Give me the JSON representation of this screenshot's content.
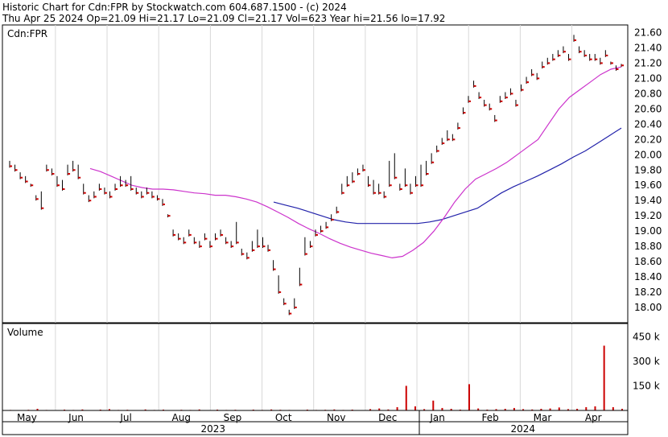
{
  "header": {
    "line1": "Historic Chart for Cdn:FPR by Stockwatch.com 604.687.1500 - (c) 2024",
    "line2": "Thu Apr 25 2024   Op=21.09   Hi=21.17   Lo=21.09   Cl=21.17   Vol=623   Year hi=21.56   lo=17.92"
  },
  "price_panel": {
    "symbol_label": "Cdn:FPR"
  },
  "volume_panel": {
    "label": "Volume"
  },
  "colors": {
    "bar": "#000000",
    "close_tick": "#cc0000",
    "ma_short": "#cc33cc",
    "ma_long": "#2222aa",
    "grid": "#d8d8d8",
    "volume": "#cc0000"
  },
  "chart_data": {
    "type": "line",
    "ylim": [
      17.8,
      21.7
    ],
    "y_ticks": [
      "21.60",
      "21.40",
      "21.20",
      "21.00",
      "20.80",
      "20.60",
      "20.40",
      "20.20",
      "20.00",
      "19.80",
      "19.60",
      "19.40",
      "19.20",
      "19.00",
      "18.80",
      "18.60",
      "18.40",
      "18.20",
      "18.00"
    ],
    "months": [
      "May",
      "Jun",
      "Jul",
      "Aug",
      "Sep",
      "Oct",
      "Nov",
      "Dec",
      "Jan",
      "Feb",
      "Mar",
      "Apr"
    ],
    "years": [
      "2023",
      "2024"
    ],
    "grid": true,
    "volume_ticks": [
      "450 k",
      "300 k",
      "150 k"
    ],
    "volume_ylim": [
      0,
      530
    ],
    "series": [
      {
        "points": [
          [
            19.9,
            19.85
          ],
          [
            19.85,
            19.8
          ],
          [
            19.75,
            19.7
          ],
          [
            19.7,
            19.65
          ],
          [
            19.6,
            19.6
          ],
          [
            19.45,
            19.42
          ],
          [
            19.5,
            19.3
          ],
          [
            19.85,
            19.8
          ],
          [
            19.8,
            19.75
          ],
          [
            19.7,
            19.6
          ],
          [
            19.65,
            19.55
          ],
          [
            19.85,
            19.75
          ],
          [
            19.9,
            19.8
          ],
          [
            19.85,
            19.7
          ],
          [
            19.6,
            19.5
          ],
          [
            19.45,
            19.4
          ],
          [
            19.5,
            19.45
          ],
          [
            19.6,
            19.55
          ],
          [
            19.55,
            19.5
          ],
          [
            19.5,
            19.45
          ],
          [
            19.6,
            19.55
          ],
          [
            19.7,
            19.6
          ],
          [
            19.65,
            19.6
          ],
          [
            19.7,
            19.55
          ],
          [
            19.55,
            19.5
          ],
          [
            19.5,
            19.45
          ],
          [
            19.55,
            19.5
          ],
          [
            19.5,
            19.45
          ],
          [
            19.45,
            19.42
          ],
          [
            19.4,
            19.35
          ],
          [
            19.2,
            19.2
          ],
          [
            19.0,
            18.95
          ],
          [
            18.95,
            18.9
          ],
          [
            18.9,
            18.85
          ],
          [
            19.0,
            18.95
          ],
          [
            18.9,
            18.85
          ],
          [
            18.85,
            18.8
          ],
          [
            18.95,
            18.9
          ],
          [
            18.85,
            18.8
          ],
          [
            18.95,
            18.9
          ],
          [
            19.0,
            18.95
          ],
          [
            18.9,
            18.85
          ],
          [
            18.85,
            18.8
          ],
          [
            19.1,
            18.85
          ],
          [
            18.75,
            18.7
          ],
          [
            18.7,
            18.65
          ],
          [
            18.85,
            18.75
          ],
          [
            19.0,
            18.8
          ],
          [
            18.9,
            18.8
          ],
          [
            18.8,
            18.75
          ],
          [
            18.6,
            18.5
          ],
          [
            18.4,
            18.2
          ],
          [
            18.1,
            18.05
          ],
          [
            17.95,
            17.92
          ],
          [
            18.1,
            18.0
          ],
          [
            18.5,
            18.3
          ],
          [
            18.9,
            18.7
          ],
          [
            18.85,
            18.8
          ],
          [
            19.0,
            18.95
          ],
          [
            19.05,
            19.0
          ],
          [
            19.1,
            19.05
          ],
          [
            19.2,
            19.15
          ],
          [
            19.3,
            19.25
          ],
          [
            19.6,
            19.5
          ],
          [
            19.7,
            19.6
          ],
          [
            19.75,
            19.65
          ],
          [
            19.8,
            19.75
          ],
          [
            19.85,
            19.8
          ],
          [
            19.7,
            19.6
          ],
          [
            19.65,
            19.5
          ],
          [
            19.6,
            19.5
          ],
          [
            19.5,
            19.45
          ],
          [
            19.9,
            19.6
          ],
          [
            20.0,
            19.7
          ],
          [
            19.6,
            19.55
          ],
          [
            19.8,
            19.6
          ],
          [
            19.6,
            19.5
          ],
          [
            19.7,
            19.6
          ],
          [
            19.85,
            19.6
          ],
          [
            19.9,
            19.75
          ],
          [
            20.0,
            19.9
          ],
          [
            20.1,
            20.05
          ],
          [
            20.2,
            20.15
          ],
          [
            20.3,
            20.2
          ],
          [
            20.25,
            20.2
          ],
          [
            20.4,
            20.35
          ],
          [
            20.6,
            20.55
          ],
          [
            20.75,
            20.7
          ],
          [
            20.95,
            20.9
          ],
          [
            20.8,
            20.75
          ],
          [
            20.7,
            20.65
          ],
          [
            20.65,
            20.6
          ],
          [
            20.5,
            20.45
          ],
          [
            20.75,
            20.7
          ],
          [
            20.8,
            20.75
          ],
          [
            20.85,
            20.8
          ],
          [
            20.7,
            20.65
          ],
          [
            20.9,
            20.85
          ],
          [
            21.0,
            20.95
          ],
          [
            21.1,
            21.05
          ],
          [
            21.05,
            21.0
          ],
          [
            21.2,
            21.15
          ],
          [
            21.25,
            21.2
          ],
          [
            21.3,
            21.25
          ],
          [
            21.35,
            21.3
          ],
          [
            21.4,
            21.35
          ],
          [
            21.3,
            21.25
          ],
          [
            21.55,
            21.5
          ],
          [
            21.4,
            21.35
          ],
          [
            21.35,
            21.3
          ],
          [
            21.3,
            21.25
          ],
          [
            21.3,
            21.25
          ],
          [
            21.25,
            21.2
          ],
          [
            21.35,
            21.3
          ],
          [
            21.2,
            21.2
          ],
          [
            21.15,
            21.12
          ],
          [
            21.17,
            21.17
          ]
        ]
      },
      {
        "name": "",
        "values": [
          19.82,
          19.78,
          19.72,
          19.66,
          19.6,
          19.57,
          19.55,
          19.55,
          19.54,
          19.52,
          19.5,
          19.49,
          19.47,
          19.47,
          19.45,
          19.42,
          19.38,
          19.32,
          19.25,
          19.18,
          19.1,
          19.03,
          18.97,
          18.9,
          18.84,
          18.79,
          18.75,
          18.71,
          18.68,
          18.65,
          18.67,
          18.75,
          18.85,
          19.0,
          19.18,
          19.38,
          19.55,
          19.68,
          19.75,
          19.82,
          19.9,
          20.0,
          20.1,
          20.2,
          20.4,
          20.6,
          20.75,
          20.85,
          20.95,
          21.05,
          21.12,
          21.15
        ]
      },
      {
        "name": "",
        "values": [
          19.38,
          19.34,
          19.3,
          19.25,
          19.2,
          19.15,
          19.12,
          19.1,
          19.1,
          19.1,
          19.1,
          19.1,
          19.1,
          19.12,
          19.15,
          19.2,
          19.25,
          19.3,
          19.4,
          19.5,
          19.58,
          19.65,
          19.72,
          19.8,
          19.88,
          19.97,
          20.05,
          20.15,
          20.25,
          20.35
        ]
      }
    ],
    "volume_values_k": [
      3,
      2,
      4,
      10,
      3,
      2,
      5,
      3,
      6,
      2,
      5,
      8,
      3,
      4,
      2,
      6,
      3,
      5,
      2,
      4,
      3,
      6,
      2,
      5,
      3,
      4,
      2,
      5,
      3,
      6,
      4,
      3,
      2,
      5,
      3,
      4,
      6,
      3,
      5,
      2,
      8,
      12,
      6,
      20,
      150,
      25,
      8,
      60,
      15,
      10,
      5,
      160,
      12,
      5,
      8,
      10,
      15,
      8,
      6,
      10,
      12,
      18,
      8,
      10,
      20,
      25,
      395,
      20,
      10
    ]
  }
}
